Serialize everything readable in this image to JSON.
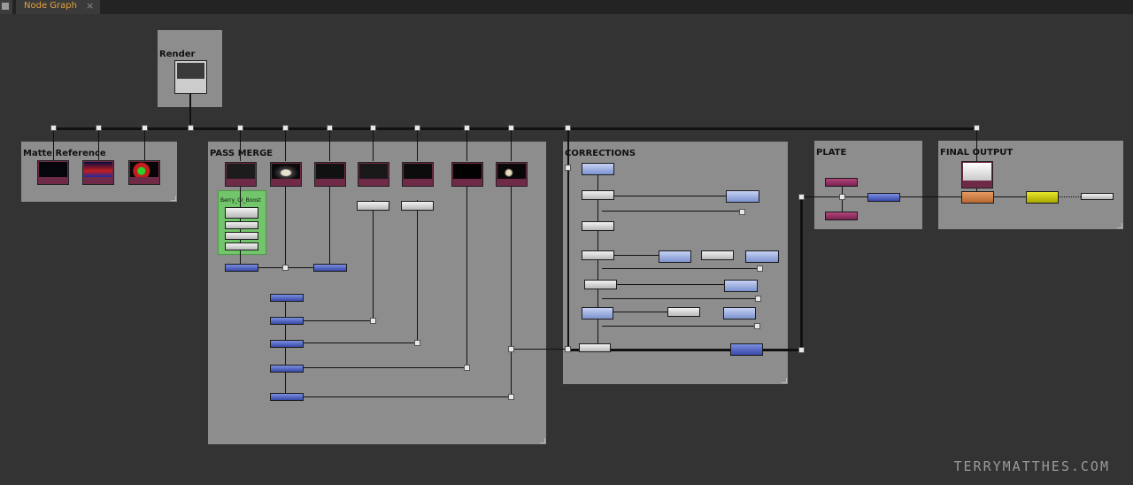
{
  "tab": {
    "label": "Node Graph",
    "close": "×"
  },
  "backdrops": {
    "render": "Render",
    "matte": "Matte Reference",
    "pass_merge": "PASS MERGE",
    "corrections": "CORRECTIONS",
    "plate": "PLATE",
    "final": "FINAL OUTPUT"
  },
  "group_label": "Berry_GI_Boost",
  "brand": "TERRYMATTHES.COM",
  "colors": {
    "tab_text": "#e5a13a",
    "group": "#72c56a"
  }
}
